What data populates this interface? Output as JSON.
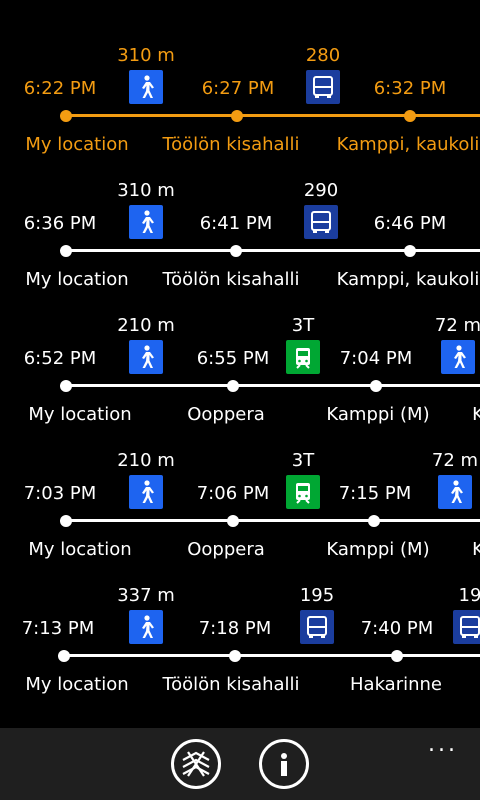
{
  "routes": [
    {
      "departure": "6:22 PM",
      "selected": true,
      "legs": [
        {
          "mode": "walk",
          "icon": "walk-icon",
          "label": "310 m"
        },
        {
          "mode": "bus",
          "icon": "bus-icon",
          "label": "280"
        }
      ],
      "times": [
        "6:22 PM",
        "6:27 PM",
        "6:32 PM"
      ],
      "stops": [
        "My location",
        "Töölön kisahalli",
        "Kamppi, kaukoli"
      ]
    },
    {
      "departure": "6:36 PM",
      "selected": false,
      "legs": [
        {
          "mode": "walk",
          "icon": "walk-icon",
          "label": "310 m"
        },
        {
          "mode": "bus",
          "icon": "bus-icon",
          "label": "290"
        }
      ],
      "times": [
        "6:36 PM",
        "6:41 PM",
        "6:46 PM"
      ],
      "stops": [
        "My location",
        "Töölön kisahalli",
        "Kamppi, kaukoli"
      ]
    },
    {
      "departure": "6:52 PM",
      "selected": false,
      "legs": [
        {
          "mode": "walk",
          "icon": "walk-icon",
          "label": "210 m"
        },
        {
          "mode": "tram",
          "icon": "tram-icon",
          "label": "3T"
        },
        {
          "mode": "walk",
          "icon": "walk-icon",
          "label": "72 m"
        }
      ],
      "times": [
        "6:52 PM",
        "6:55 PM",
        "7:04 PM"
      ],
      "stops": [
        "My location",
        "Ooppera",
        "Kamppi (M)",
        "K"
      ]
    },
    {
      "departure": "7:03 PM",
      "selected": false,
      "legs": [
        {
          "mode": "walk",
          "icon": "walk-icon",
          "label": "210 m"
        },
        {
          "mode": "tram",
          "icon": "tram-icon",
          "label": "3T"
        },
        {
          "mode": "walk",
          "icon": "walk-icon",
          "label": "72 m"
        }
      ],
      "times": [
        "7:03 PM",
        "7:06 PM",
        "7:15 PM"
      ],
      "stops": [
        "My location",
        "Ooppera",
        "Kamppi (M)",
        "K"
      ]
    },
    {
      "departure": "7:13 PM",
      "selected": false,
      "legs": [
        {
          "mode": "walk",
          "icon": "walk-icon",
          "label": "337 m"
        },
        {
          "mode": "bus",
          "icon": "bus-icon",
          "label": "195"
        },
        {
          "mode": "bus",
          "icon": "bus-icon",
          "label": "19"
        }
      ],
      "times": [
        "7:13 PM",
        "7:18 PM",
        "7:40 PM"
      ],
      "stops": [
        "My location",
        "Töölön kisahalli",
        "Hakarinne"
      ]
    }
  ],
  "appbar": {
    "map_button_icon": "globe-map-icon",
    "info_button_icon": "info-icon",
    "more_label": "..."
  },
  "colors": {
    "selected": "#f39c12",
    "walk": "#1e64f0",
    "bus": "#1b3d9e",
    "tram": "#00a733",
    "appbar": "#1f1f1f"
  }
}
